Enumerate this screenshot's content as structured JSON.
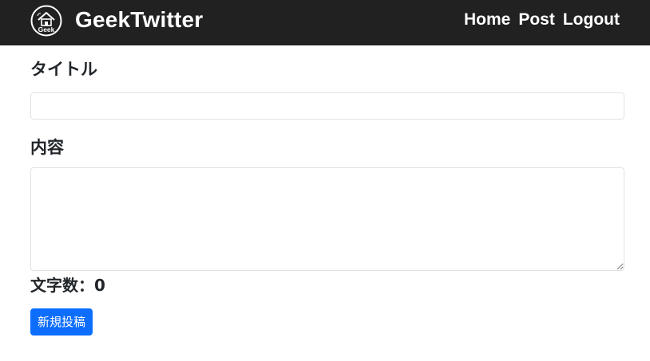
{
  "navbar": {
    "logo_text": "Geek",
    "brand": "GeekTwitter",
    "links": [
      {
        "label": "Home"
      },
      {
        "label": "Post"
      },
      {
        "label": "Logout"
      }
    ],
    "background_color": "#212121"
  },
  "form": {
    "title_label": "タイトル",
    "title_value": "",
    "content_label": "内容",
    "content_value": "",
    "char_count_label": "文字数：",
    "char_count_value": "0",
    "submit_label": "新規投稿",
    "accent_color": "#0d6efd"
  },
  "icons": {
    "logo": "geek-house-logo-icon"
  }
}
